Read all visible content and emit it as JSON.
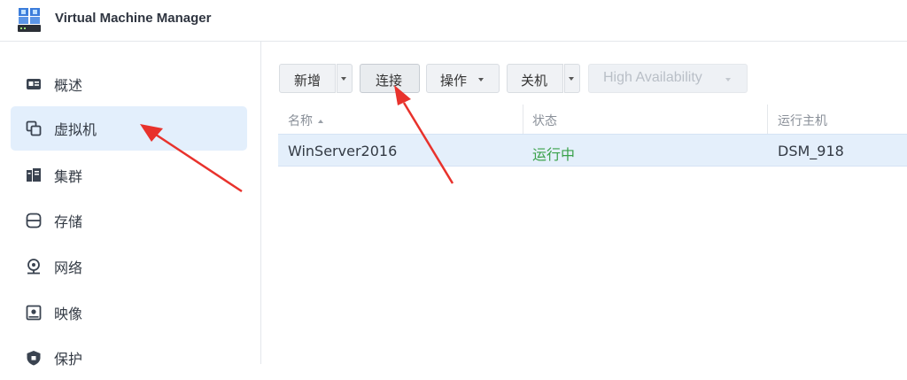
{
  "app": {
    "title": "Virtual Machine Manager",
    "icon": "vmm-app-icon"
  },
  "sidebar": {
    "items": [
      {
        "label": "概述",
        "icon": "overview-icon",
        "active": false
      },
      {
        "label": "虚拟机",
        "icon": "virtual-machine-icon",
        "active": true
      },
      {
        "label": "集群",
        "icon": "cluster-icon",
        "active": false
      },
      {
        "label": "存储",
        "icon": "storage-icon",
        "active": false
      },
      {
        "label": "网络",
        "icon": "network-icon",
        "active": false
      },
      {
        "label": "映像",
        "icon": "image-icon",
        "active": false
      },
      {
        "label": "保护",
        "icon": "protection-icon",
        "active": false
      }
    ]
  },
  "toolbar": {
    "add_label": "新增",
    "connect_label": "连接",
    "action_label": "操作",
    "shutdown_label": "关机",
    "ha_label": "High Availability"
  },
  "table": {
    "columns": [
      "名称",
      "状态",
      "运行主机"
    ],
    "rows": [
      {
        "name": "WinServer2016",
        "status": "运行中",
        "host": "DSM_918"
      }
    ]
  },
  "colors": {
    "accent_active_bg": "#e3effc",
    "selected_row_bg": "#e4effb",
    "status_running": "#3aa14a",
    "annotation_arrow": "#e8322c"
  }
}
